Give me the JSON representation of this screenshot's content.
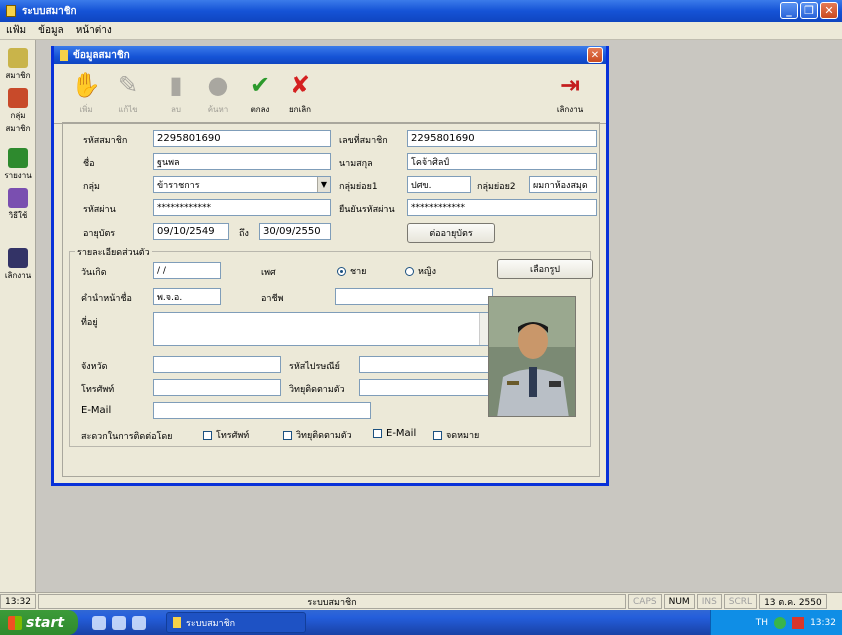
{
  "app": {
    "title": "ระบบสมาชิก"
  },
  "menu": [
    "แฟ้ม",
    "ข้อมูล",
    "หน้าต่าง"
  ],
  "sidebar": [
    {
      "label": "สมาชิก",
      "icon": "member-icon",
      "color": "#c9b44a"
    },
    {
      "label": "กลุ่มสมาชิก",
      "icon": "group-icon",
      "color": "#c84a2a"
    },
    {
      "label": "รายงาน",
      "icon": "report-icon",
      "color": "#2e8a2e"
    },
    {
      "label": "วิธีใช้",
      "icon": "help-icon",
      "color": "#7a4fb0"
    },
    {
      "label": "เลิกงาน",
      "icon": "exit-icon",
      "color": "#333366"
    }
  ],
  "dialog": {
    "title": "ข้อมูลสมาชิก",
    "toolbar": {
      "add": "เพิ่ม",
      "edit": "แก้ไข",
      "delete": "ลบ",
      "search": "ค้นหา",
      "ok": "ตกลง",
      "cancel": "ยกเลิก",
      "exit": "เลิกงาน"
    },
    "fields": {
      "member_code_label": "รหัสสมาชิก",
      "member_code": "2295801690",
      "member_no_label": "เลขที่สมาชิก",
      "member_no": "2295801690",
      "first_name_label": "ชื่อ",
      "first_name": "ฐนพล",
      "last_name_label": "นามสกุล",
      "last_name": "โคจ้าศิลป์",
      "group_label": "กลุ่ม",
      "group": "ข้าราชการ",
      "subgroup1_label": "กลุ่มย่อย1",
      "subgroup1": "ปศข.",
      "subgroup2_label": "กลุ่มย่อย2",
      "subgroup2": "ผมกาห้องสมุด",
      "password_label": "รหัสผ่าน",
      "password": "************",
      "confirm_password_label": "ยืนยันรหัสผ่าน",
      "confirm_password": "************",
      "valid_label": "อายุบัตร",
      "valid_from": "09/10/2549",
      "to_label": "ถึง",
      "valid_to": "30/09/2550",
      "renew_button": "ต่ออายุบัตร"
    },
    "personal": {
      "legend": "รายละเอียดส่วนตัว",
      "birthday_label": "วันเกิด",
      "birthday": "/ /",
      "gender_label": "เพศ",
      "male": "ชาย",
      "female": "หญิง",
      "choose_photo": "เลือกรูป",
      "title_label": "คำนำหน้าชื่อ",
      "title_value": "พ.จ.อ.",
      "occupation_label": "อาชีพ",
      "address_label": "ที่อยู่",
      "province_label": "จังหวัด",
      "postcode_label": "รหัสไปรษณีย์",
      "phone_label": "โทรศัพท์",
      "radio_label": "วิทยุติดตามตัว",
      "email_label": "E-Mail",
      "contact_label": "สะดวกในการติดต่อโดย",
      "contact_phone": "โทรศัพท์",
      "contact_radio": "วิทยุติดตามตัว",
      "contact_email": "E-Mail",
      "contact_mail": "จดหมาย"
    }
  },
  "status": {
    "time": "13:32",
    "center": "ระบบสมาชิก",
    "caps": "CAPS",
    "num": "NUM",
    "ins": "INS",
    "scrl": "SCRL",
    "date": "13 ต.ค. 2550"
  },
  "taskbar": {
    "start": "start",
    "task": "ระบบสมาชิก",
    "lang": "TH",
    "clock": "13:32"
  }
}
